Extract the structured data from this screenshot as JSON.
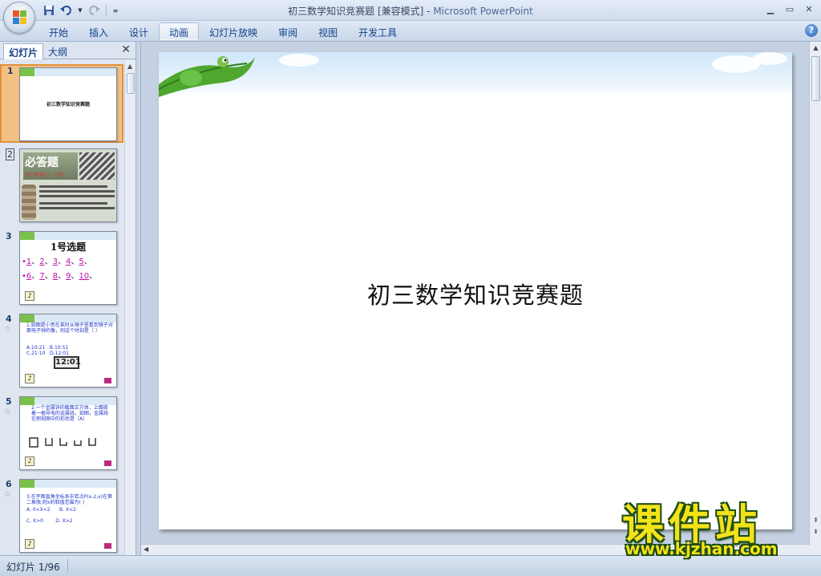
{
  "window": {
    "title_doc": "初三数学知识竞赛题 [兼容模式]",
    "title_sep": " - ",
    "title_app": "Microsoft PowerPoint",
    "controls": {
      "minimize": "▁",
      "maximize": "▭",
      "close": "✕"
    }
  },
  "ribbon": {
    "tabs": [
      "开始",
      "插入",
      "设计",
      "动画",
      "幻灯片放映",
      "审阅",
      "视图",
      "开发工具"
    ],
    "active_tab_index": 3,
    "help": "?"
  },
  "left_panel": {
    "tab_slides": "幻灯片",
    "tab_outline": "大纲",
    "close": "✕",
    "slides": [
      {
        "num": "1",
        "title": "初三数学知识竞赛题"
      },
      {
        "num": "2",
        "title": "必答题",
        "subtitle": "每个题目小，只答"
      },
      {
        "num": "3",
        "title": "1号选题",
        "row1": [
          "1",
          "2",
          "3",
          "4",
          "5"
        ],
        "row2": [
          "6",
          "7",
          "8",
          "9",
          "10"
        ]
      },
      {
        "num": "4",
        "text": "1.如图是小亮在某时从镜子里看到镜子对面电子钟的像，则这个时刻是（ ）",
        "options": "A.10:21   B.10:51\nC.21:10   D.12:01",
        "clock": "12:01"
      },
      {
        "num": "5",
        "text": "2.一个金属锌的截面正方体，上面嵌着一根导电的金属线，如图，金属线在侧视图中的形状是（A）"
      },
      {
        "num": "6",
        "text": "3.在平面直角坐标系中若点P(x-2,x)在第二象限,则x的取值范围为(   )",
        "options": "A. 0<X<2      B. X<2\n\nC. X>0        D. X>2"
      }
    ],
    "star": "☆"
  },
  "slide": {
    "title": "初三数学知识竞赛题"
  },
  "status": {
    "slide_counter": "幻灯片 1/96"
  },
  "watermark": {
    "title": "课件站",
    "url": "www.kjzhan.com"
  }
}
